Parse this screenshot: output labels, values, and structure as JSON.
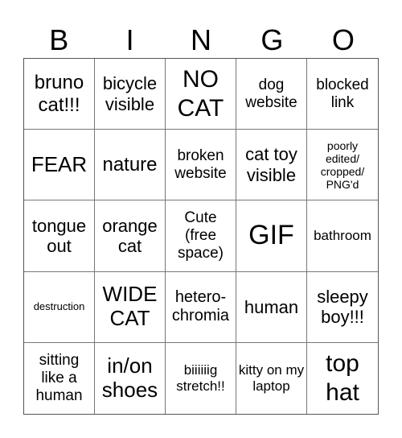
{
  "header": [
    "B",
    "I",
    "N",
    "G",
    "O"
  ],
  "cells": [
    [
      "bruno cat!!!",
      "bicycle visible",
      "NO CAT",
      "dog website",
      "blocked link"
    ],
    [
      "FEAR",
      "nature",
      "broken website",
      "cat toy visible",
      "poorly edited/ cropped/ PNG'd"
    ],
    [
      "tongue out",
      "orange cat",
      "Cute (free space)",
      "GIF",
      "bathroom"
    ],
    [
      "destruction",
      "WIDE CAT",
      "hetero-chromia",
      "human",
      "sleepy boy!!!"
    ],
    [
      "sitting like a human",
      "in/on shoes",
      "biiiiiig stretch!!",
      "kitty on my laptop",
      "top hat"
    ]
  ]
}
